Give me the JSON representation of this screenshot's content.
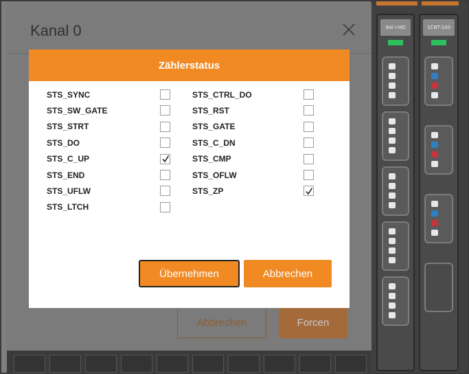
{
  "outer_dialog": {
    "title": "Kanal 0",
    "buttons": {
      "cancel": "Abbrechen",
      "force": "Forcen"
    }
  },
  "inner_dialog": {
    "title": "Zählerstatus",
    "left_column": [
      {
        "label": "STS_SYNC",
        "checked": false
      },
      {
        "label": "STS_SW_GATE",
        "checked": false
      },
      {
        "label": "STS_STRT",
        "checked": false
      },
      {
        "label": "STS_DO",
        "checked": false
      },
      {
        "label": "STS_C_UP",
        "checked": true
      },
      {
        "label": "STS_END",
        "checked": false
      },
      {
        "label": "STS_UFLW",
        "checked": false
      },
      {
        "label": "STS_LTCH",
        "checked": false
      }
    ],
    "right_column": [
      {
        "label": "STS_CTRL_DO",
        "checked": false
      },
      {
        "label": "STS_RST",
        "checked": false
      },
      {
        "label": "STS_GATE",
        "checked": false
      },
      {
        "label": "STS_C_DN",
        "checked": false
      },
      {
        "label": "STS_CMP",
        "checked": false
      },
      {
        "label": "STS_OFLW",
        "checked": false
      },
      {
        "label": "STS_ZP",
        "checked": true
      }
    ],
    "buttons": {
      "apply": "Übernehmen",
      "cancel": "Abbrechen"
    }
  },
  "rack": {
    "modules": [
      {
        "label": "8AI I-HD"
      },
      {
        "label": "1CNT-100"
      }
    ]
  },
  "colors": {
    "accent": "#f18a22",
    "overlay": "#7f7f7f",
    "led": "#2ec05c"
  },
  "icons": {
    "close": "close-icon",
    "check": "check-icon"
  }
}
